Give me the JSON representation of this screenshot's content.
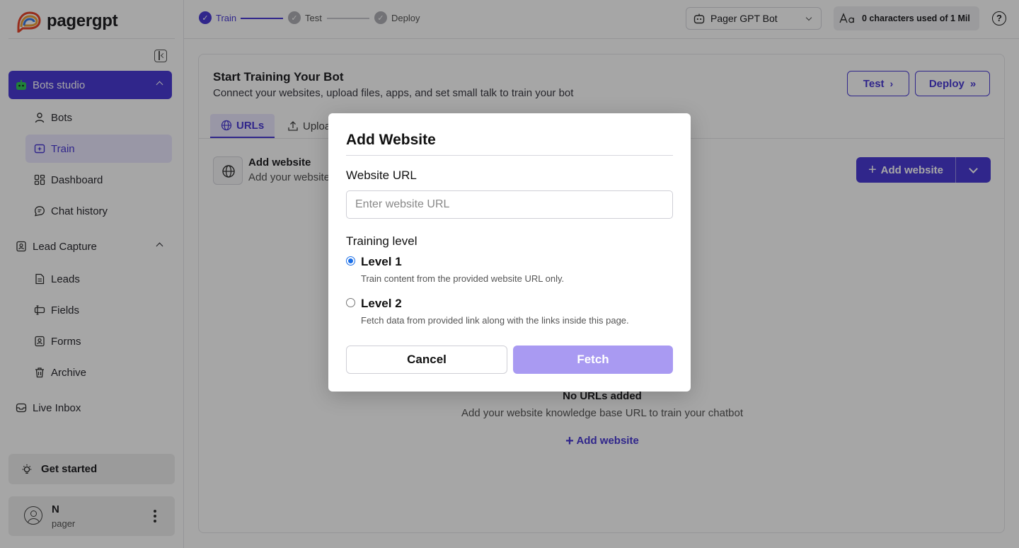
{
  "brand": {
    "name": "pagergpt"
  },
  "sidebar": {
    "groups": [
      {
        "label": "Bots studio",
        "icon": "bot-icon"
      },
      {
        "label": "Lead Capture",
        "icon": "contact-icon"
      },
      {
        "label": "Live Inbox",
        "icon": "inbox-icon"
      }
    ],
    "bots_items": [
      {
        "label": "Bots",
        "icon": "user-icon"
      },
      {
        "label": "Train",
        "icon": "train-icon"
      },
      {
        "label": "Dashboard",
        "icon": "dashboard-icon"
      },
      {
        "label": "Chat history",
        "icon": "chat-icon"
      }
    ],
    "lead_items": [
      {
        "label": "Leads",
        "icon": "document-icon"
      },
      {
        "label": "Fields",
        "icon": "fields-icon"
      },
      {
        "label": "Forms",
        "icon": "form-icon"
      },
      {
        "label": "Archive",
        "icon": "trash-icon"
      }
    ],
    "get_started": "Get started",
    "user": {
      "initial": "N",
      "org": "pager"
    }
  },
  "topbar": {
    "steps": [
      {
        "label": "Train",
        "state": "active"
      },
      {
        "label": "Test",
        "state": "pending"
      },
      {
        "label": "Deploy",
        "state": "pending"
      }
    ],
    "bot_select": "Pager GPT Bot",
    "chars_used": "0 characters used of 1 Mil",
    "help": "?"
  },
  "main": {
    "title": "Start Training Your Bot",
    "subtitle": "Connect your websites, upload files, apps, and set small talk to train your bot",
    "test_button": "Test",
    "deploy_button": "Deploy",
    "tabs": [
      {
        "label": "URLs"
      },
      {
        "label": "Uploa"
      }
    ],
    "section_title": "Add website",
    "section_sub": "Add your website",
    "add_website_button": "Add website",
    "empty_title": "No URLs added",
    "empty_sub": "Add your website knowledge base URL to train your chatbot",
    "empty_link": "Add website"
  },
  "modal": {
    "title": "Add Website",
    "url_label": "Website URL",
    "url_placeholder": "Enter website URL",
    "url_value": "",
    "training_label": "Training level",
    "levels": [
      {
        "label": "Level 1",
        "desc": "Train content from the provided website URL only.",
        "checked": true
      },
      {
        "label": "Level 2",
        "desc": "Fetch data from provided link along with the links inside this page.",
        "checked": false
      }
    ],
    "cancel": "Cancel",
    "fetch": "Fetch"
  },
  "colors": {
    "accent": "#4a3bd6",
    "accent_light": "#ece8ff",
    "fetch_disabled": "#a99af2",
    "radio": "#1a6ee8"
  }
}
